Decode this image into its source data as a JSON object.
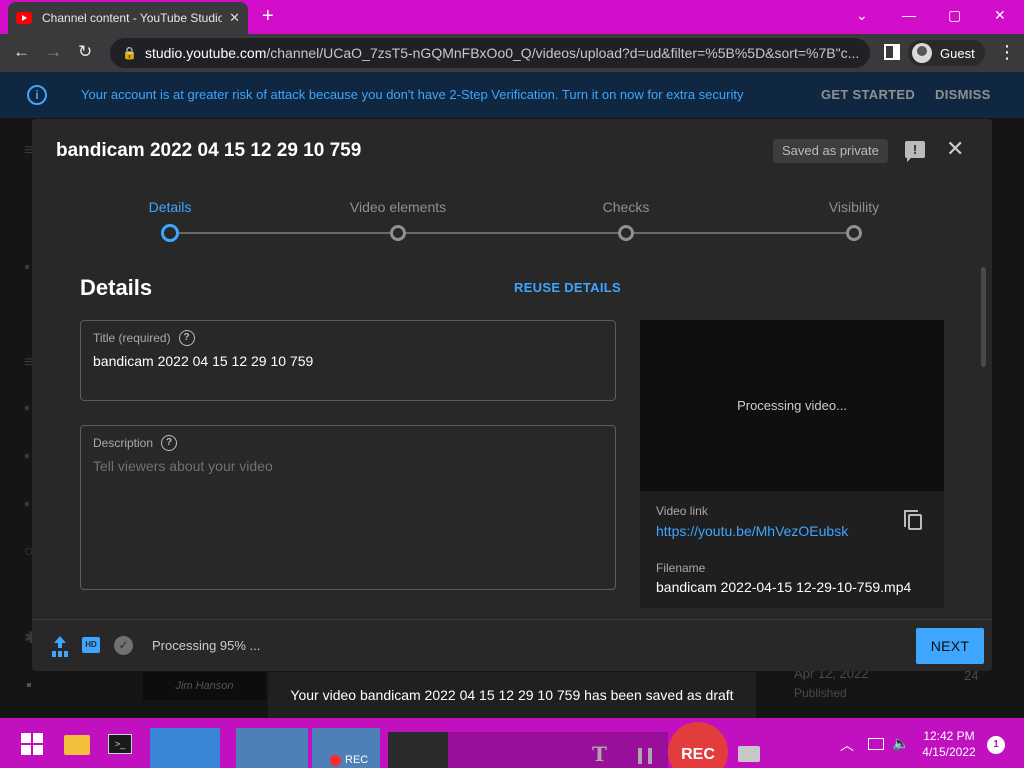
{
  "browser": {
    "tab_title": "Channel content - YouTube Studio",
    "tab_close": "✕",
    "new_tab": "+",
    "window_controls": {
      "minimize": "—",
      "maximize": "▢",
      "close": "✕",
      "tab_search": "⌄"
    },
    "nav": {
      "back": "←",
      "forward": "→",
      "reload": "↻"
    },
    "url_host": "studio.youtube.com",
    "url_path": "/channel/UCaO_7zsT5-nGQMnFBxOo0_Q/videos/upload?d=ud&filter=%5B%5D&sort=%7B\"c...",
    "profile_label": "Guest",
    "menu": "⋮"
  },
  "banner": {
    "message": "Your account is at greater risk of attack because you don't have 2-Step Verification. Turn it on now for extra security",
    "get_started": "GET STARTED",
    "dismiss": "DISMISS",
    "info_glyph": "i"
  },
  "dialog": {
    "title": "bandicam 2022 04 15 12 29 10 759",
    "saved_chip": "Saved as private",
    "feedback_glyph": "!",
    "close_glyph": "✕",
    "steps": [
      "Details",
      "Video elements",
      "Checks",
      "Visibility"
    ],
    "active_step": 0,
    "section_heading": "Details",
    "reuse_details": "REUSE DETAILS",
    "title_field": {
      "label": "Title (required)",
      "value": "bandicam 2022 04 15 12 29 10 759"
    },
    "description_field": {
      "label": "Description",
      "placeholder": "Tell viewers about your video"
    },
    "help_glyph": "?",
    "video": {
      "processing_text": "Processing video...",
      "link_label": "Video link",
      "link": "https://youtu.be/MhVezOEubsk",
      "filename_label": "Filename",
      "filename": "bandicam 2022-04-15 12-29-10-759.mp4"
    },
    "footer": {
      "status": "Processing 95% ...",
      "progress_percent": 95,
      "hd_glyph": "HD",
      "check_glyph": "✓",
      "next": "NEXT"
    }
  },
  "backdrop": {
    "thumb_text": "Jim Hanson",
    "date": "Apr 12, 2022",
    "status": "Published",
    "count": "24"
  },
  "toast": {
    "message": "Your video bandicam 2022 04 15 12 29 10 759 has been saved as draft"
  },
  "taskbar": {
    "cmd_glyph": ">_",
    "rec_small": "REC",
    "rec_big": "REC",
    "text_tool": "T",
    "clock_time": "12:42 PM",
    "clock_date": "4/15/2022",
    "notification_count": "1",
    "tray_chevron": "︿",
    "tray_volume": "🔈"
  },
  "colors": {
    "accent": "#3ea6ff",
    "tabstrip": "#d30ecb",
    "taskbar": "#c010c0",
    "dialog_bg": "#282828",
    "rec_red": "#e33c3c"
  }
}
